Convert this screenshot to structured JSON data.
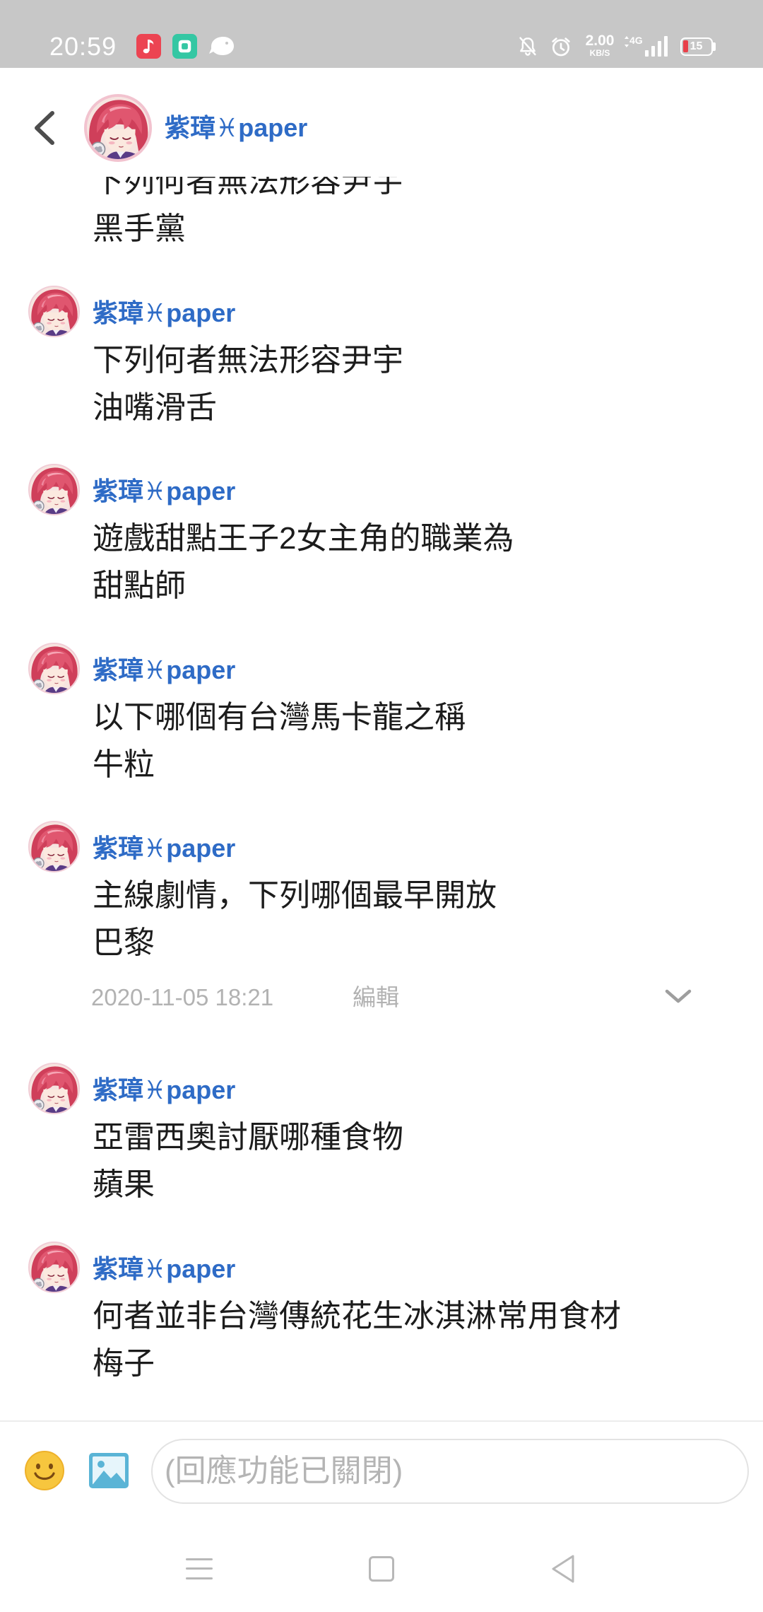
{
  "status_bar": {
    "time": "20:59",
    "app_icons": [
      "music-app-icon",
      "chat-app-icon",
      "bird-app-icon"
    ],
    "system_icons": [
      "bell-off-icon",
      "alarm-clock-icon",
      "signal-icon",
      "battery-icon"
    ],
    "network_speed": "2.00",
    "network_speed_unit": "KB/S",
    "network_type": "4G",
    "battery_level": "15"
  },
  "header": {
    "back_icon": "chevron-left-icon",
    "user_name": "紫璋♓paper"
  },
  "thread": {
    "partial_message": {
      "question": "下列何者無法形容尹宇",
      "answer": "黑手黨"
    },
    "messages": [
      {
        "author": "紫璋♓paper",
        "question": "下列何者無法形容尹宇",
        "answer": "油嘴滑舌"
      },
      {
        "author": "紫璋♓paper",
        "question": "遊戲甜點王子2女主角的職業為",
        "answer": "甜點師"
      },
      {
        "author": "紫璋♓paper",
        "question": "以下哪個有台灣馬卡龍之稱",
        "answer": "牛粒"
      },
      {
        "author": "紫璋♓paper",
        "question": "主線劇情，下列哪個最早開放",
        "answer": "巴黎",
        "meta": {
          "timestamp": "2020-11-05 18:21",
          "edit_label": "編輯",
          "expand_icon": "chevron-down-icon"
        }
      },
      {
        "author": "紫璋♓paper",
        "question": "亞雷西奧討厭哪種食物",
        "answer": "蘋果"
      },
      {
        "author": "紫璋♓paper",
        "question": "何者並非台灣傳統花生冰淇淋常用食材",
        "answer": "梅子"
      }
    ]
  },
  "composer": {
    "emoji_icon": "smiley-icon",
    "image_icon": "image-icon",
    "placeholder": "(回應功能已關閉)"
  },
  "nav_bar": {
    "icons": [
      "menu-icon",
      "home-square-icon",
      "back-triangle-icon"
    ]
  },
  "colors": {
    "status_bar_bg": "#c7c7c7",
    "name_blue": "#2e6bc6",
    "text": "#1c1c1c",
    "muted": "#b2b2b2",
    "battery_low": "#e8404a",
    "emoji_yellow": "#f7c63e",
    "image_icon_blue": "#5ab4d6"
  }
}
